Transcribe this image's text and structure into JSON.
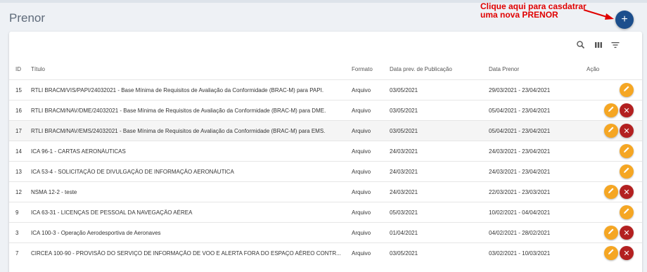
{
  "header": {
    "title": "Prenor",
    "annotation_line1": "Clique aqui para casdatrar",
    "annotation_line2": "uma nova PRENOR",
    "add_label": "+"
  },
  "toolbar": {
    "icons": [
      "search-icon",
      "columns-icon",
      "filter-icon"
    ]
  },
  "table": {
    "headers": {
      "id": "ID",
      "title": "Título",
      "format": "Formato",
      "pub": "Data prev. de Publicação",
      "prenor": "Data Prenor",
      "action": "Ação"
    },
    "rows": [
      {
        "id": "15",
        "title": "RTLI BRACM/VIS/PAPI/24032021 - Base Mínima de Requisitos de Avaliação da Conformidade (BRAC-M) para PAPI.",
        "format": "Arquivo",
        "pub": "03/05/2021",
        "prenor": "29/03/2021 - 23/04/2021",
        "edit": true,
        "delete": false
      },
      {
        "id": "16",
        "title": "RTLI BRACM/NAV/DME/24032021 - Base Mínima de Requisitos de Avaliação da Conformidade (BRAC-M) para DME.",
        "format": "Arquivo",
        "pub": "03/05/2021",
        "prenor": "05/04/2021 - 23/04/2021",
        "edit": true,
        "delete": true
      },
      {
        "id": "17",
        "title": "RTLI BRACM/NAV/EMS/24032021 - Base Mínima de Requisitos de Avaliação da Conformidade (BRAC-M) para EMS.",
        "format": "Arquivo",
        "pub": "03/05/2021",
        "prenor": "05/04/2021 - 23/04/2021",
        "edit": true,
        "delete": true
      },
      {
        "id": "14",
        "title": "ICA 96-1 - CARTAS AERONÁUTICAS",
        "format": "Arquivo",
        "pub": "24/03/2021",
        "prenor": "24/03/2021 - 23/04/2021",
        "edit": true,
        "delete": false
      },
      {
        "id": "13",
        "title": "ICA 53-4 - SOLICITAÇÃO DE DIVULGAÇÃO DE INFORMAÇÃO AERONÁUTICA",
        "format": "Arquivo",
        "pub": "24/03/2021",
        "prenor": "24/03/2021 - 23/04/2021",
        "edit": true,
        "delete": false
      },
      {
        "id": "12",
        "title": "NSMA 12-2 - teste",
        "format": "Arquivo",
        "pub": "24/03/2021",
        "prenor": "22/03/2021 - 23/03/2021",
        "edit": true,
        "delete": true
      },
      {
        "id": "9",
        "title": "ICA 63-31 - LICENÇAS DE PESSOAL DA NAVEGAÇÃO AÉREA",
        "format": "Arquivo",
        "pub": "05/03/2021",
        "prenor": "10/02/2021 - 04/04/2021",
        "edit": true,
        "delete": false
      },
      {
        "id": "3",
        "title": "ICA 100-3 - Operação Aerodesportiva de Aeronaves",
        "format": "Arquivo",
        "pub": "01/04/2021",
        "prenor": "04/02/2021 - 28/02/2021",
        "edit": true,
        "delete": true
      },
      {
        "id": "7",
        "title": "CIRCEA 100-90 - PROVISÃO DO SERVIÇO DE INFORMAÇÃO DE VOO E ALERTA FORA DO ESPAÇO AÉREO CONTR...",
        "format": "Arquivo",
        "pub": "03/05/2021",
        "prenor": "03/02/2021 - 10/03/2021",
        "edit": true,
        "delete": true
      }
    ]
  },
  "colors": {
    "edit": "#f5a623",
    "delete": "#b32020",
    "fab": "#1c4e8c",
    "annotation": "#e00000"
  }
}
